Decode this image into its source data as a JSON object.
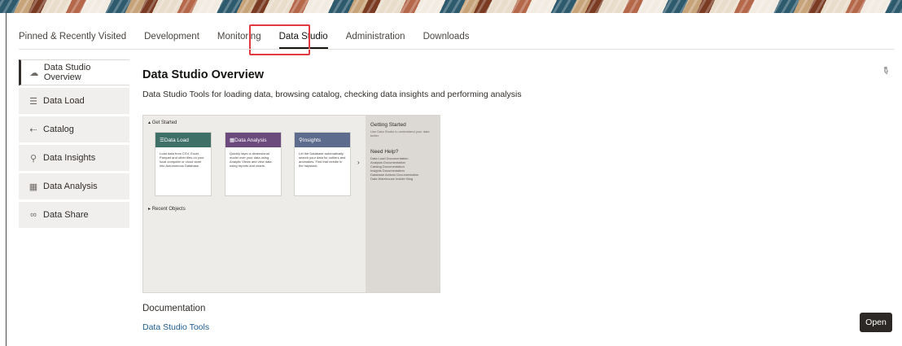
{
  "tabs": [
    {
      "label": "Pinned & Recently Visited"
    },
    {
      "label": "Development"
    },
    {
      "label": "Monitoring"
    },
    {
      "label": "Data Studio"
    },
    {
      "label": "Administration"
    },
    {
      "label": "Downloads"
    }
  ],
  "active_tab": "Data Studio",
  "sidebar": {
    "items": [
      {
        "label": "Data Studio Overview",
        "icon": "cloud-icon"
      },
      {
        "label": "Data Load",
        "icon": "data-load-icon"
      },
      {
        "label": "Catalog",
        "icon": "catalog-icon"
      },
      {
        "label": "Data Insights",
        "icon": "insights-icon"
      },
      {
        "label": "Data Analysis",
        "icon": "analysis-icon"
      },
      {
        "label": "Data Share",
        "icon": "share-icon"
      }
    ]
  },
  "main": {
    "title": "Data Studio Overview",
    "subtitle": "Data Studio Tools for loading data, browsing catalog, checking data insights and performing analysis",
    "preview": {
      "get_started": "Get Started",
      "recent_objects": "Recent Objects",
      "cards": [
        {
          "title": "Data Load",
          "color": "#3f7068",
          "body": "Load data from CSV, Excel, Parquet and other files on your local computer or cloud store into Autonomous Database."
        },
        {
          "title": "Data Analysis",
          "color": "#6b4a7e",
          "body": "Quickly layer a dimensional model over your data using Analytic Views and view data using reports and charts."
        },
        {
          "title": "Insights",
          "color": "#5d6c8c",
          "body": "Let the Database automatically search your data for outliers and anomalies. Find that needle in the haystack."
        }
      ],
      "side": {
        "getting_started": "Getting Started",
        "getting_started_text": "Use Data Studio to understand your data better",
        "need_help": "Need Help?",
        "links": [
          "Data Load Documentation",
          "Analysis Documentation",
          "Catalog Documentation",
          "Insights Documentation",
          "Database Actions Documentation",
          "Data Warehouse Insider Blog"
        ]
      }
    },
    "documentation_title": "Documentation",
    "documentation_link": "Data Studio Tools",
    "open_button": "Open"
  },
  "colors": {
    "highlight_box": "#e0393e",
    "link": "#1f5d91",
    "button_bg": "#2b2825"
  }
}
